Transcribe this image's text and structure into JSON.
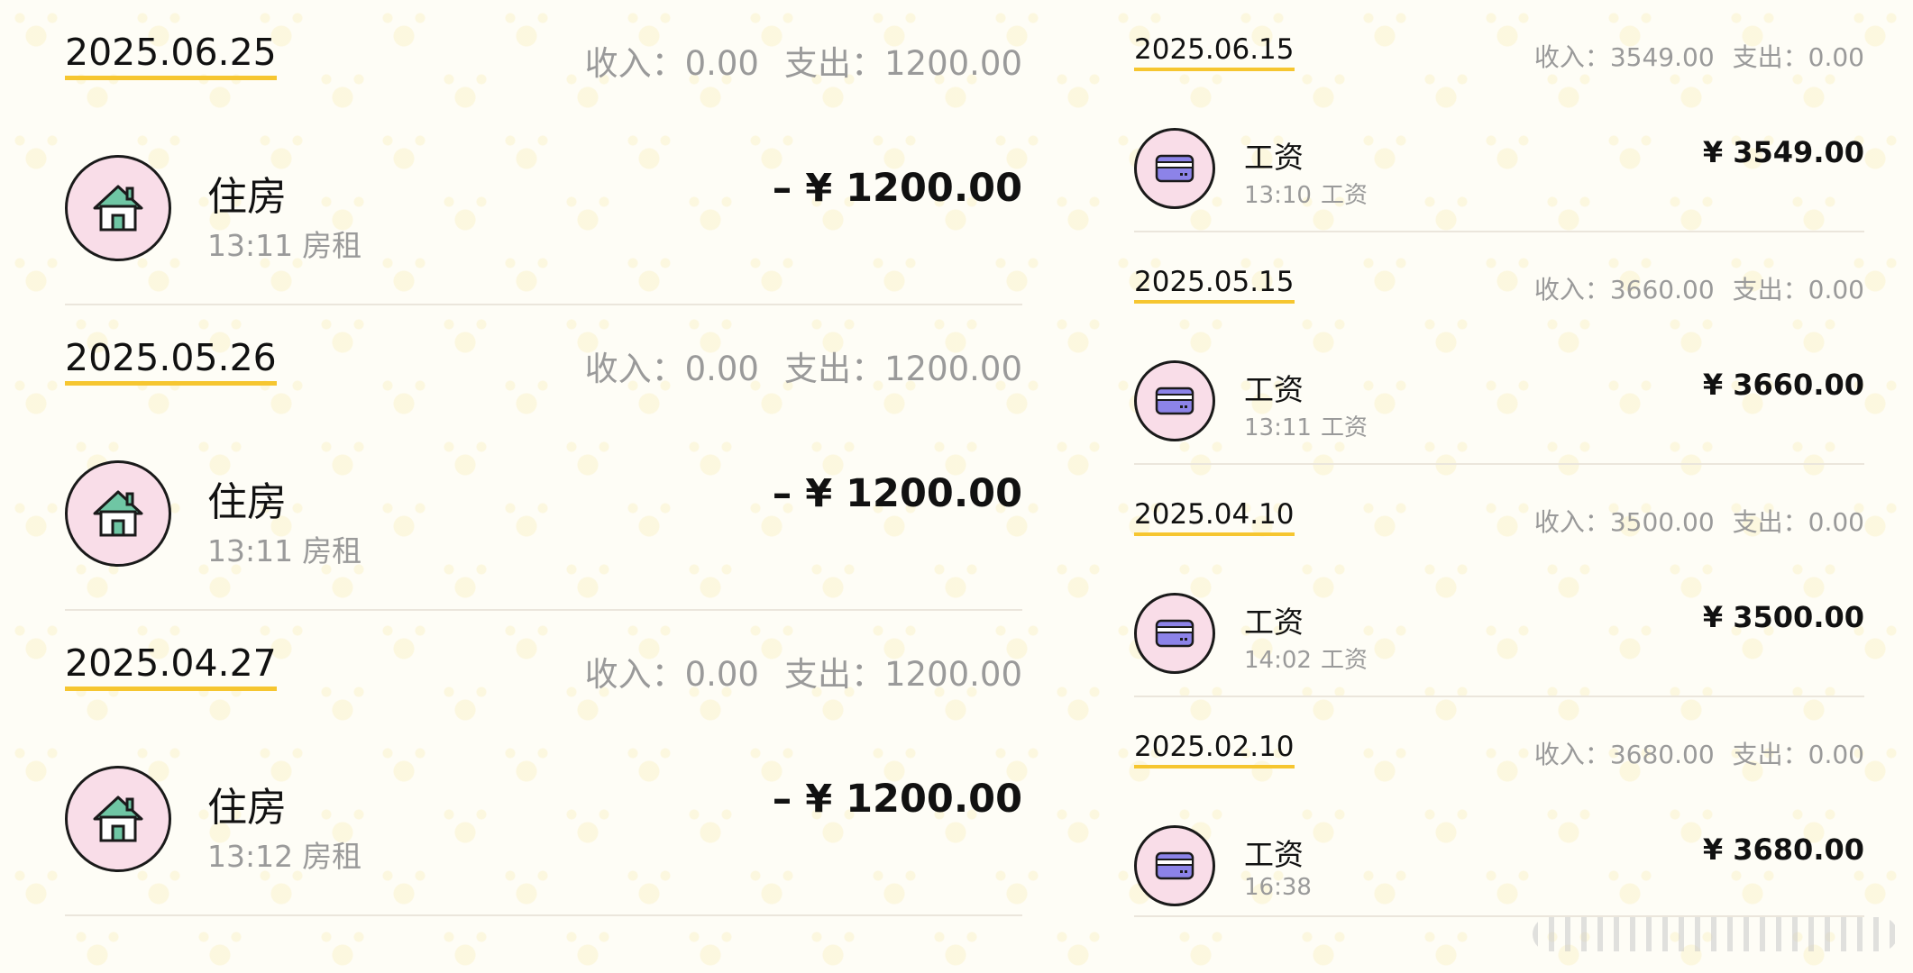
{
  "colors": {
    "date_underline": "#f6c630",
    "icon_bg": "#f9dde8",
    "house_icon": "#6fc6a4",
    "card_icon": "#8c83e8",
    "muted_text": "#9a9a9a",
    "main_text": "#111111"
  },
  "left_groups": [
    {
      "date": "2025.06.25",
      "income_label": "收入：",
      "income_value": "0.00",
      "expense_label": "支出：",
      "expense_value": "1200.00",
      "tx": {
        "icon": "house-icon",
        "category": "住房",
        "time": "13:11",
        "note": "房租",
        "amount": "– ¥ 1200.00"
      }
    },
    {
      "date": "2025.05.26",
      "income_label": "收入：",
      "income_value": "0.00",
      "expense_label": "支出：",
      "expense_value": "1200.00",
      "tx": {
        "icon": "house-icon",
        "category": "住房",
        "time": "13:11",
        "note": "房租",
        "amount": "– ¥ 1200.00"
      }
    },
    {
      "date": "2025.04.27",
      "income_label": "收入：",
      "income_value": "0.00",
      "expense_label": "支出：",
      "expense_value": "1200.00",
      "tx": {
        "icon": "house-icon",
        "category": "住房",
        "time": "13:12",
        "note": "房租",
        "amount": "– ¥ 1200.00"
      }
    }
  ],
  "right_groups": [
    {
      "date": "2025.06.15",
      "income_label": "收入：",
      "income_value": "3549.00",
      "expense_label": "支出：",
      "expense_value": "0.00",
      "tx": {
        "icon": "card-icon",
        "category": "工资",
        "time": "13:10",
        "note": "工资",
        "amount": "¥ 3549.00"
      }
    },
    {
      "date": "2025.05.15",
      "income_label": "收入：",
      "income_value": "3660.00",
      "expense_label": "支出：",
      "expense_value": "0.00",
      "tx": {
        "icon": "card-icon",
        "category": "工资",
        "time": "13:11",
        "note": "工资",
        "amount": "¥ 3660.00"
      }
    },
    {
      "date": "2025.04.10",
      "income_label": "收入：",
      "income_value": "3500.00",
      "expense_label": "支出：",
      "expense_value": "0.00",
      "tx": {
        "icon": "card-icon",
        "category": "工资",
        "time": "14:02",
        "note": "工资",
        "amount": "¥ 3500.00"
      }
    },
    {
      "date": "2025.02.10",
      "income_label": "收入：",
      "income_value": "3680.00",
      "expense_label": "支出：",
      "expense_value": "0.00",
      "tx": {
        "icon": "card-icon",
        "category": "工资",
        "time": "16:38",
        "note": "",
        "amount": "¥ 3680.00"
      }
    }
  ]
}
